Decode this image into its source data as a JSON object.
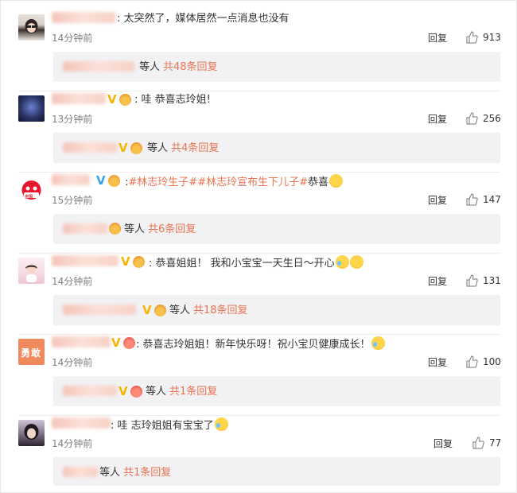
{
  "actions": {
    "reply_label": "回复"
  },
  "comments": [
    {
      "text_segments": [
        ": 太突然了，媒体居然一点消息也没有"
      ],
      "time": "14分钟前",
      "likes": "913",
      "replies_prefix": "等人",
      "replies_link": "共48条回复"
    },
    {
      "text_segments": [
        ": 哇 恭喜志玲姐!"
      ],
      "time": "13分钟前",
      "likes": "256",
      "replies_prefix": "等人",
      "replies_link": "共4条回复"
    },
    {
      "topic1": "#林志玲生子#",
      "topic2": "#林志玲宣布生下儿子#",
      "text_tail": "恭喜",
      "time": "15分钟前",
      "likes": "147",
      "replies_prefix": "等人",
      "replies_link": "共6条回复"
    },
    {
      "text_segments": [
        ": 恭喜姐姐！ 我和小宝宝一天生日～开心"
      ],
      "time": "14分钟前",
      "likes": "131",
      "replies_prefix": "等人",
      "replies_link": "共18条回复"
    },
    {
      "text_segments": [
        ": 恭喜志玲姐姐！新年快乐呀！祝小宝贝健康成长！"
      ],
      "time": "14分钟前",
      "likes": "100",
      "replies_prefix": "等人",
      "replies_link": "共1条回复"
    },
    {
      "text_segments": [
        ": 哇 志玲姐姐有宝宝了"
      ],
      "time": "14分钟前",
      "likes": "77",
      "replies_prefix": "等人",
      "replies_link": "共1条回复"
    }
  ],
  "avatars": {
    "c3_logo_text": "全国",
    "c5_logo_text": "勇敢"
  },
  "icons": {
    "like": "thumbs-up-icon",
    "verified": "verified-v-icon",
    "member": "member-crown-icon"
  },
  "colors": {
    "link": "#eb7350",
    "meta_text": "#808080",
    "panel": "#f2f2f5",
    "verified_gold": "#f7b500",
    "verified_blue": "#3aa1e8"
  }
}
